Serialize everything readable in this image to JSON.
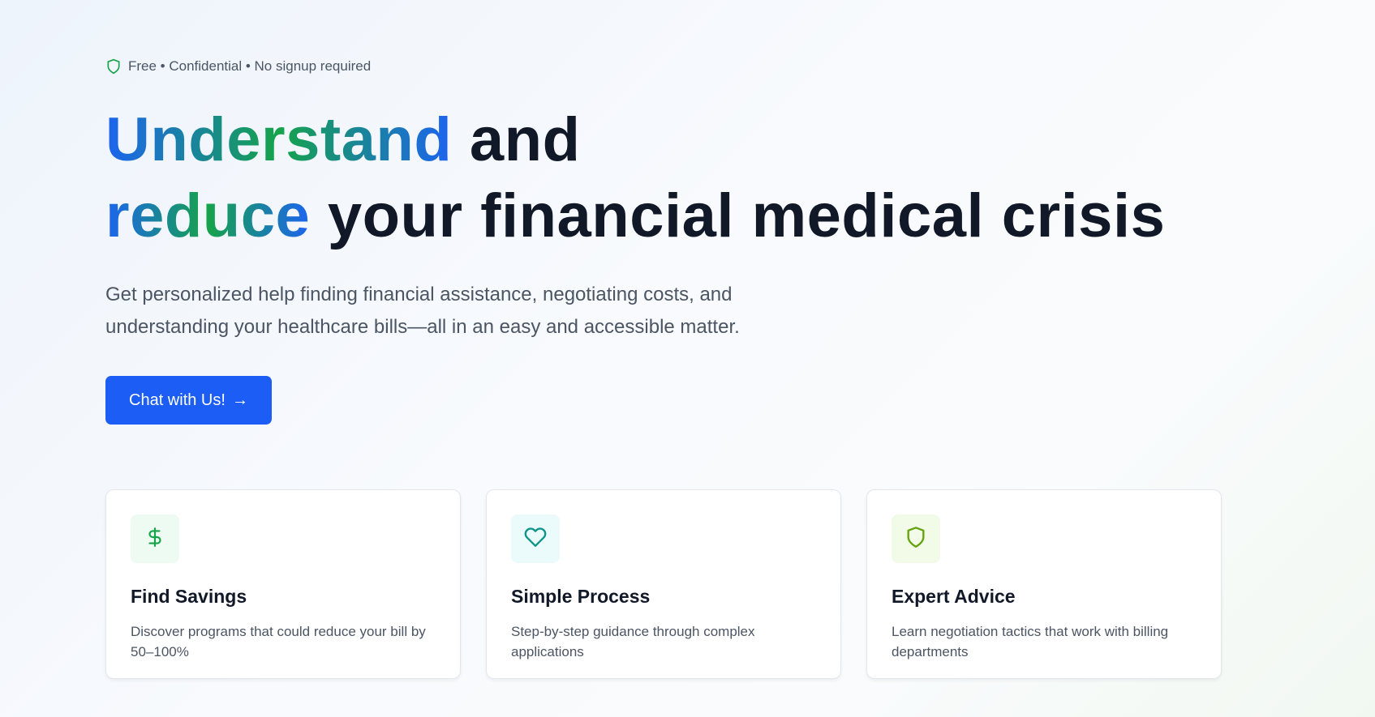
{
  "hero": {
    "trust_line": "Free • Confidential • No signup required",
    "headline": {
      "line1_highlight": "Understand",
      "line1_rest": " and",
      "line2_highlight": "reduce",
      "line2_rest": " your financial medical crisis"
    },
    "subheadline": "Get personalized help finding financial assistance, negotiating costs, and understanding your healthcare bills—all in an easy and accessible matter.",
    "cta": {
      "label": "Chat with Us!",
      "arrow": "→"
    }
  },
  "features": [
    {
      "icon": "dollar-icon",
      "title": "Find Savings",
      "description": "Discover programs that could reduce your bill by 50–100%",
      "icon_color": "#16a34a",
      "badge_color": "#eefbf2"
    },
    {
      "icon": "heart-icon",
      "title": "Simple Process",
      "description": "Step-by-step guidance through complex applications",
      "icon_color": "#0d9488",
      "badge_color": "#ebfafa"
    },
    {
      "icon": "shield-icon",
      "title": "Expert Advice",
      "description": "Learn negotiation tactics that work with billing departments",
      "icon_color": "#65a30d",
      "badge_color": "#f2fbe8"
    }
  ],
  "colors": {
    "primary": "#1c5ef5",
    "gradient_blue": "#1d64f0",
    "gradient_green": "#16a34a",
    "heading": "#111827",
    "body_text": "#4b5563"
  }
}
